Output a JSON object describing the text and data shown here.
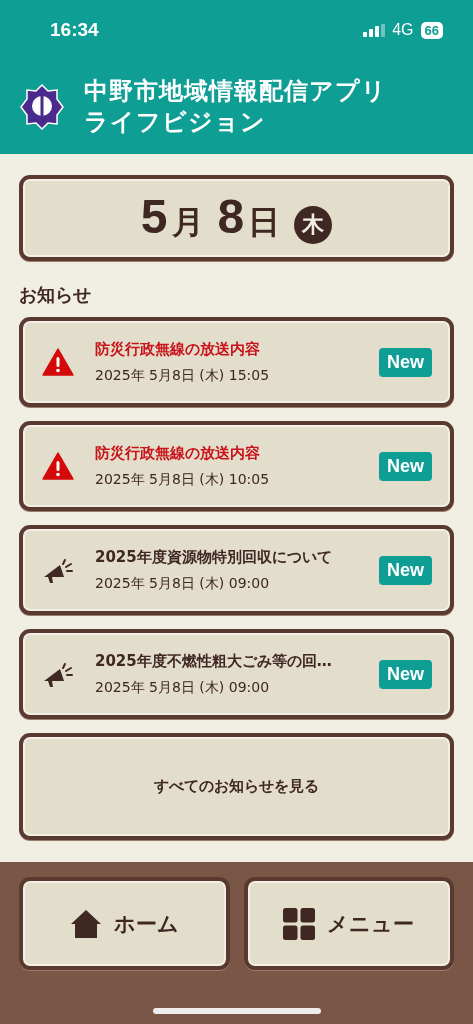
{
  "status_bar": {
    "time": "16:34",
    "network": "4G",
    "battery": "66"
  },
  "header": {
    "title_line1": "中野市地域情報配信アプリ",
    "title_line2": "ライフビジョン"
  },
  "date": {
    "month": "5",
    "month_suffix": "月",
    "day": "8",
    "day_suffix": "日",
    "weekday": "木"
  },
  "notices_heading": "お知らせ",
  "notices": [
    {
      "kind": "alert",
      "title": "防災行政無線の放送内容",
      "datetime": "2025年 5月8日 (木) 15:05",
      "badge": "New"
    },
    {
      "kind": "alert",
      "title": "防災行政無線の放送内容",
      "datetime": "2025年 5月8日 (木) 10:05",
      "badge": "New"
    },
    {
      "kind": "info",
      "title": "2025年度資源物特別回収について",
      "datetime": "2025年 5月8日 (木) 09:00",
      "badge": "New"
    },
    {
      "kind": "info",
      "title": "2025年度不燃性粗大ごみ等の回…",
      "datetime": "2025年 5月8日 (木) 09:00",
      "badge": "New"
    }
  ],
  "see_all": "すべてのお知らせを見る",
  "nav": [
    {
      "kind": "home",
      "label": "ホーム"
    },
    {
      "kind": "menu",
      "label": "メニュー"
    }
  ]
}
